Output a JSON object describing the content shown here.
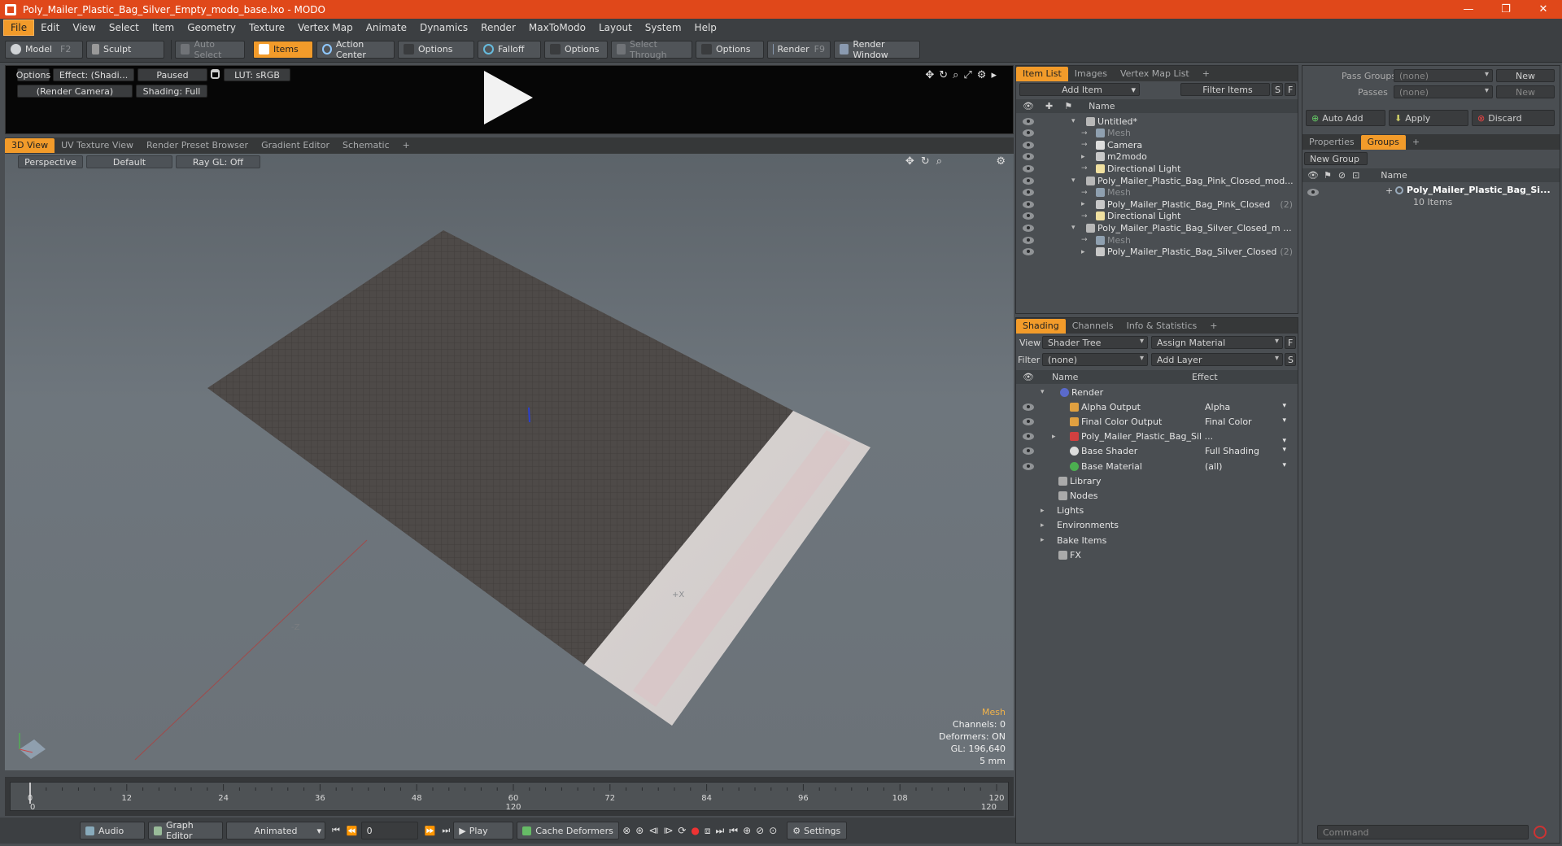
{
  "window": {
    "title": "Poly_Mailer_Plastic_Bag_Silver_Empty_modo_base.lxo - MODO",
    "minimize": "—",
    "maximize": "❐",
    "close": "✕"
  },
  "menu": [
    "File",
    "Edit",
    "View",
    "Select",
    "Item",
    "Geometry",
    "Texture",
    "Vertex Map",
    "Animate",
    "Dynamics",
    "Render",
    "MaxToModo",
    "Layout",
    "System",
    "Help"
  ],
  "toolbar": {
    "model": "Model",
    "model_key": "F2",
    "sculpt": "Sculpt",
    "auto_select": "Auto Select",
    "items": "Items",
    "action_center": "Action Center",
    "options1": "Options",
    "falloff": "Falloff",
    "options2": "Options",
    "select_through": "Select Through",
    "options3": "Options",
    "render": "Render",
    "render_key": "F9",
    "render_window": "Render Window"
  },
  "preview": {
    "options": "Options",
    "effect": "Effect: (Shadi...",
    "paused": "Paused",
    "lut": "LUT: sRGB",
    "camera": "(Render Camera)",
    "shading": "Shading: Full"
  },
  "viewport_tabs": [
    "3D View",
    "UV Texture View",
    "Render Preset Browser",
    "Gradient Editor",
    "Schematic",
    "+"
  ],
  "viewport": {
    "perspective": "Perspective",
    "default": "Default",
    "raygl": "Ray GL: Off",
    "hud": {
      "mesh": "Mesh",
      "channels": "Channels: 0",
      "deformers": "Deformers: ON",
      "gl": "GL: 196,640",
      "scale": "5 mm"
    },
    "axis_x": "+X",
    "axis_z": "-Z"
  },
  "timeline": {
    "ticks": [
      "0",
      "12",
      "24",
      "36",
      "48",
      "60",
      "72",
      "84",
      "96",
      "108",
      "120"
    ],
    "start": "0",
    "mid": "120",
    "end": "120"
  },
  "bottombar": {
    "audio": "Audio",
    "graph_editor": "Graph Editor",
    "animated": "Animated",
    "frame": "0",
    "play": "Play",
    "cache_deformers": "Cache Deformers",
    "settings": "Settings"
  },
  "item_list": {
    "tabs": [
      "Item List",
      "Images",
      "Vertex Map List",
      "+"
    ],
    "add_item": "Add Item",
    "filter_items": "Filter Items",
    "s": "S",
    "f": "F",
    "col_name": "Name",
    "rows": [
      {
        "label": "Untitled*",
        "indent": 0,
        "kind": "scene",
        "ghost": false,
        "count": ""
      },
      {
        "label": "Mesh",
        "indent": 1,
        "kind": "mesh",
        "ghost": true,
        "count": ""
      },
      {
        "label": "Camera",
        "indent": 1,
        "kind": "camera",
        "ghost": false,
        "count": ""
      },
      {
        "label": "m2modo",
        "indent": 1,
        "kind": "group",
        "ghost": false,
        "count": ""
      },
      {
        "label": "Directional Light",
        "indent": 1,
        "kind": "light",
        "ghost": false,
        "count": ""
      },
      {
        "label": "Poly_Mailer_Plastic_Bag_Pink_Closed_mod...",
        "indent": 0,
        "kind": "scene",
        "ghost": false,
        "count": ""
      },
      {
        "label": "Mesh",
        "indent": 1,
        "kind": "mesh",
        "ghost": true,
        "count": ""
      },
      {
        "label": "Poly_Mailer_Plastic_Bag_Pink_Closed",
        "indent": 1,
        "kind": "group",
        "ghost": false,
        "count": "(2)"
      },
      {
        "label": "Directional Light",
        "indent": 1,
        "kind": "light",
        "ghost": false,
        "count": ""
      },
      {
        "label": "Poly_Mailer_Plastic_Bag_Silver_Closed_m ...",
        "indent": 0,
        "kind": "scene",
        "ghost": false,
        "count": ""
      },
      {
        "label": "Mesh",
        "indent": 1,
        "kind": "mesh",
        "ghost": true,
        "count": ""
      },
      {
        "label": "Poly_Mailer_Plastic_Bag_Silver_Closed",
        "indent": 1,
        "kind": "group",
        "ghost": false,
        "count": "(2)"
      }
    ]
  },
  "shading": {
    "tabs": [
      "Shading",
      "Channels",
      "Info & Statistics",
      "+"
    ],
    "view_label": "View",
    "view_value": "Shader Tree",
    "assign_material": "Assign Material",
    "f": "F",
    "filter_label": "Filter",
    "filter_value": "(none)",
    "add_layer": "Add Layer",
    "s": "S",
    "col_name": "Name",
    "col_effect": "Effect",
    "rows": [
      {
        "label": "Render",
        "effect": "",
        "indent": 0,
        "icon": "#5a6acb"
      },
      {
        "label": "Alpha Output",
        "effect": "Alpha",
        "indent": 1,
        "icon": "#e0a040"
      },
      {
        "label": "Final Color Output",
        "effect": "Final Color",
        "indent": 1,
        "icon": "#e0a040"
      },
      {
        "label": "Poly_Mailer_Plastic_Bag_Sil ...",
        "effect": "",
        "indent": 1,
        "icon": "#d04040"
      },
      {
        "label": "Base Shader",
        "effect": "Full Shading",
        "indent": 1,
        "icon": "#dddddd"
      },
      {
        "label": "Base Material",
        "effect": "(all)",
        "indent": 1,
        "icon": "#4caf50"
      },
      {
        "label": "Library",
        "effect": "",
        "indent": 0,
        "icon": "#aaaaaa"
      },
      {
        "label": "Nodes",
        "effect": "",
        "indent": 0,
        "icon": "#aaaaaa"
      },
      {
        "label": "Lights",
        "effect": "",
        "indent": -1,
        "icon": ""
      },
      {
        "label": "Environments",
        "effect": "",
        "indent": -1,
        "icon": ""
      },
      {
        "label": "Bake Items",
        "effect": "",
        "indent": -1,
        "icon": ""
      },
      {
        "label": "FX",
        "effect": "",
        "indent": 0,
        "icon": "#aaaaaa"
      }
    ]
  },
  "right": {
    "pass_groups": "Pass Groups",
    "pass_groups_value": "(none)",
    "new": "New",
    "passes": "Passes",
    "passes_value": "(none)",
    "new2": "New",
    "auto_add": "Auto Add",
    "apply": "Apply",
    "discard": "Discard",
    "tabs": [
      "Properties",
      "Groups",
      "+"
    ],
    "new_group": "New Group",
    "col_name": "Name",
    "group_name": "Poly_Mailer_Plastic_Bag_Si...",
    "group_count": "10 Items",
    "command": "Command"
  },
  "colors": {
    "accent": "#f29b2a",
    "titlebar": "#e0481a"
  }
}
